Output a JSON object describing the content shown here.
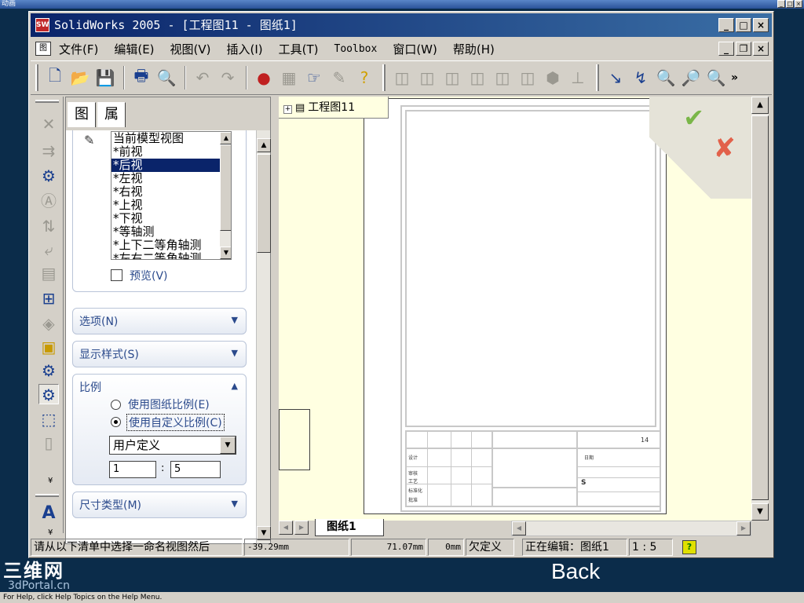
{
  "outer": {
    "title": "动画",
    "controls": [
      "_",
      "□",
      "×"
    ]
  },
  "app": {
    "logo": "SW",
    "title": "SolidWorks 2005 - [工程图11 - 图纸1]",
    "title_buttons": [
      "_",
      "□",
      "×"
    ],
    "doc_buttons": [
      "_",
      "❐",
      "×"
    ]
  },
  "menu": {
    "doc_icon": "图",
    "items": [
      "文件(F)",
      "编辑(E)",
      "视图(V)",
      "插入(I)",
      "工具(T)",
      "Toolbox",
      "窗口(W)",
      "帮助(H)"
    ]
  },
  "toolbar": {
    "icons": [
      "new-icon",
      "open-icon",
      "save-icon",
      "print-icon",
      "print-preview-icon",
      "undo-icon",
      "redo-icon",
      "rebuild-icon",
      "options-icon",
      "select-icon",
      "hide-icon",
      "help-icon",
      "front-view-icon",
      "back-view-icon",
      "left-view-icon",
      "right-view-icon",
      "top-view-icon",
      "bottom-view-icon",
      "iso-view-icon",
      "normal-to-icon",
      "pan-icon",
      "rotate-icon",
      "zoom-fit-icon",
      "zoom-area-icon",
      "zoom-in-out-icon"
    ],
    "overflow": "»"
  },
  "left_strip": {
    "more_top": "¥",
    "more_bottom": "¥",
    "annotation_icon": "A"
  },
  "pm": {
    "tab1_icon": "图",
    "tab2_icon": "属",
    "view_list": {
      "items": [
        "当前模型视图",
        "*前视",
        "*后视",
        "*左视",
        "*右视",
        "*上视",
        "*下视",
        "*等轴测",
        "*上下二等角轴测",
        "*左右二等角轴测"
      ],
      "selected_index": 2
    },
    "preview_label": "预览(V)",
    "options_title": "选项(N)",
    "display_title": "显示样式(S)",
    "scale": {
      "title": "比例",
      "use_sheet": "使用图纸比例(E)",
      "use_custom": "使用自定义比例(C)",
      "selected": "use_custom",
      "dropdown_value": "用户定义",
      "num1": "1",
      "separator": ":",
      "num2": "5"
    },
    "dim_type_title": "尺寸类型(M)"
  },
  "drawing": {
    "tree_node": "工程图11",
    "tree_expand": "+",
    "title_block_texts": [
      "14",
      "S",
      "设计",
      "审核",
      "工艺",
      "标准化",
      "批准",
      "日期"
    ],
    "ok_icon": "✔",
    "cancel_icon": "✘"
  },
  "sheet_tab": "图纸1",
  "status": {
    "message": "请从以下清单中选择一命名视图然后",
    "x": "-39.29mm",
    "y": "71.07mm",
    "z": "0mm",
    "state": "欠定义",
    "editing": "正在编辑：图纸1",
    "scale": "1 : 5",
    "help": "?"
  },
  "overlay": {
    "brand": "三维网",
    "brand_sub": "3dPortal.cn",
    "back": "Back",
    "help_line": "For Help, click Help Topics on the Help Menu."
  }
}
